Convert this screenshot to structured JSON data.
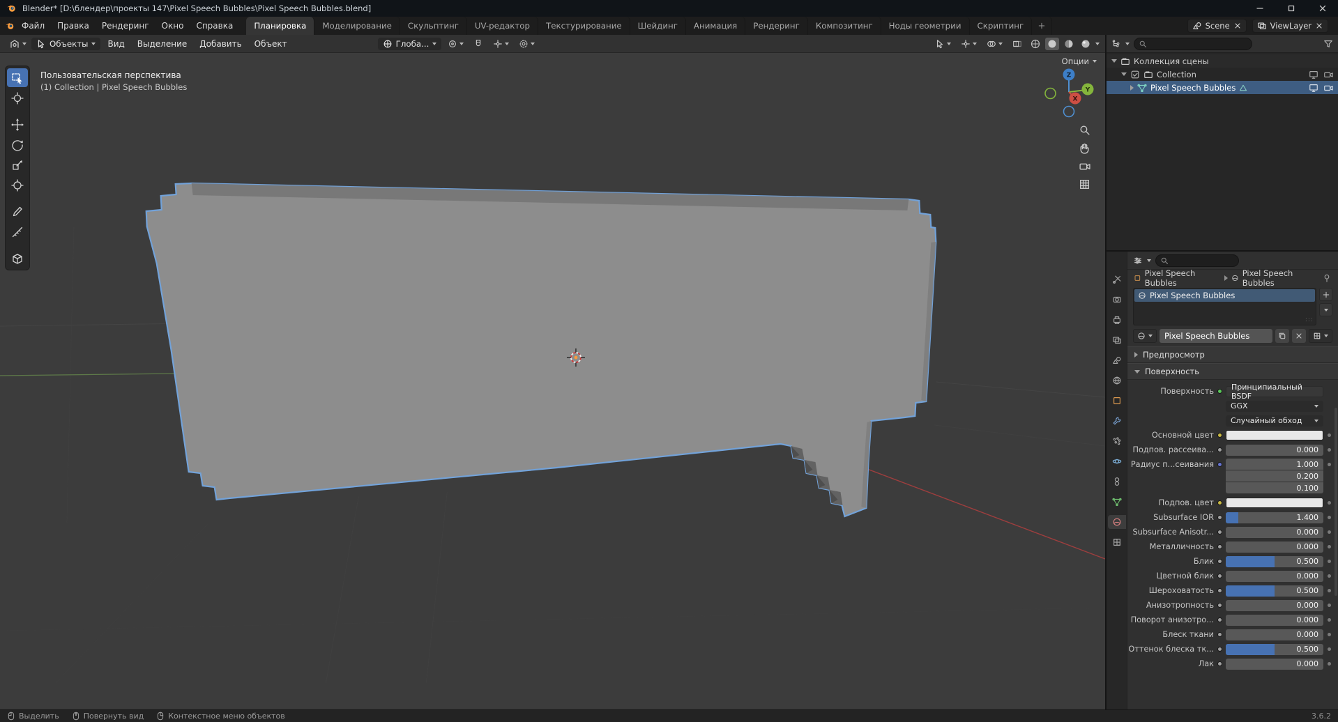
{
  "window": {
    "title": "Blender* [D:\\блендер\\проекты 147\\Pixel Speech Bubbles\\Pixel Speech Bubbles.blend]"
  },
  "topbar": {
    "menus": [
      "Файл",
      "Правка",
      "Рендеринг",
      "Окно",
      "Справка"
    ],
    "tabs": [
      "Планировка",
      "Моделирование",
      "Скульптинг",
      "UV-редактор",
      "Текстурирование",
      "Шейдинг",
      "Анимация",
      "Рендеринг",
      "Композитинг",
      "Ноды геометрии",
      "Скриптинг"
    ],
    "scene_label": "Scene",
    "viewlayer_label": "ViewLayer"
  },
  "viewport": {
    "header": {
      "mode": "Объекты",
      "menu_view": "Вид",
      "menu_select": "Выделение",
      "menu_add": "Добавить",
      "menu_object": "Объект",
      "orientation": "Глоба...",
      "options_label": "Опции"
    },
    "overlay": {
      "view_name": "Пользовательская перспектива",
      "context_path": "(1) Collection | Pixel Speech Bubbles"
    },
    "gizmo": {
      "x": "X",
      "y": "Y",
      "z": "Z"
    }
  },
  "outliner": {
    "scene_collection": "Коллекция сцены",
    "collection": "Collection",
    "object": "Pixel Speech Bubbles"
  },
  "properties": {
    "breadcrumb_object": "Pixel Speech Bubbles",
    "breadcrumb_material": "Pixel Speech Bubbles",
    "slot_name": "Pixel Speech Bubbles",
    "material_name": "Pixel Speech Bubbles",
    "preview_panel": "Предпросмотр",
    "surface_panel": "Поверхность",
    "surface_label": "Поверхность",
    "shader": "Принципиальный BSDF",
    "distribution": "GGX",
    "sss_method": "Случайный обход",
    "rows": [
      {
        "label": "Основной цвет"
      },
      {
        "label": "Подпов. рассеива...",
        "value": "0.000",
        "fill": 0
      },
      {
        "label": "Радиус п...сеивания",
        "v1": "1.000",
        "v2": "0.200",
        "v3": "0.100"
      },
      {
        "label": "Подпов. цвет"
      },
      {
        "label": "Subsurface IOR",
        "value": "1.400",
        "fill": 0.13
      },
      {
        "label": "Subsurface Anisotr...",
        "value": "0.000",
        "fill": 0
      },
      {
        "label": "Металличность",
        "value": "0.000",
        "fill": 0
      },
      {
        "label": "Блик",
        "value": "0.500",
        "fill": 0.5
      },
      {
        "label": "Цветной блик",
        "value": "0.000",
        "fill": 0
      },
      {
        "label": "Шероховатость",
        "value": "0.500",
        "fill": 0.5
      },
      {
        "label": "Анизотропность",
        "value": "0.000",
        "fill": 0
      },
      {
        "label": "Поворот анизотро...",
        "value": "0.000",
        "fill": 0
      },
      {
        "label": "Блеск ткани",
        "value": "0.000",
        "fill": 0
      },
      {
        "label": "Оттенок блеска тк...",
        "value": "0.500",
        "fill": 0.5
      },
      {
        "label": "Лак",
        "value": "0.000",
        "fill": 0
      }
    ]
  },
  "statusbar": {
    "hint_select": "Выделить",
    "hint_rotate": "Повернуть вид",
    "hint_context": "Контекстное меню объектов",
    "version": "3.6.2"
  },
  "colors": {
    "accent": "#4772b3",
    "selection": "#3e5d82",
    "object_outline": "#72a2d9",
    "color_swatch": "#e8e8e8"
  }
}
